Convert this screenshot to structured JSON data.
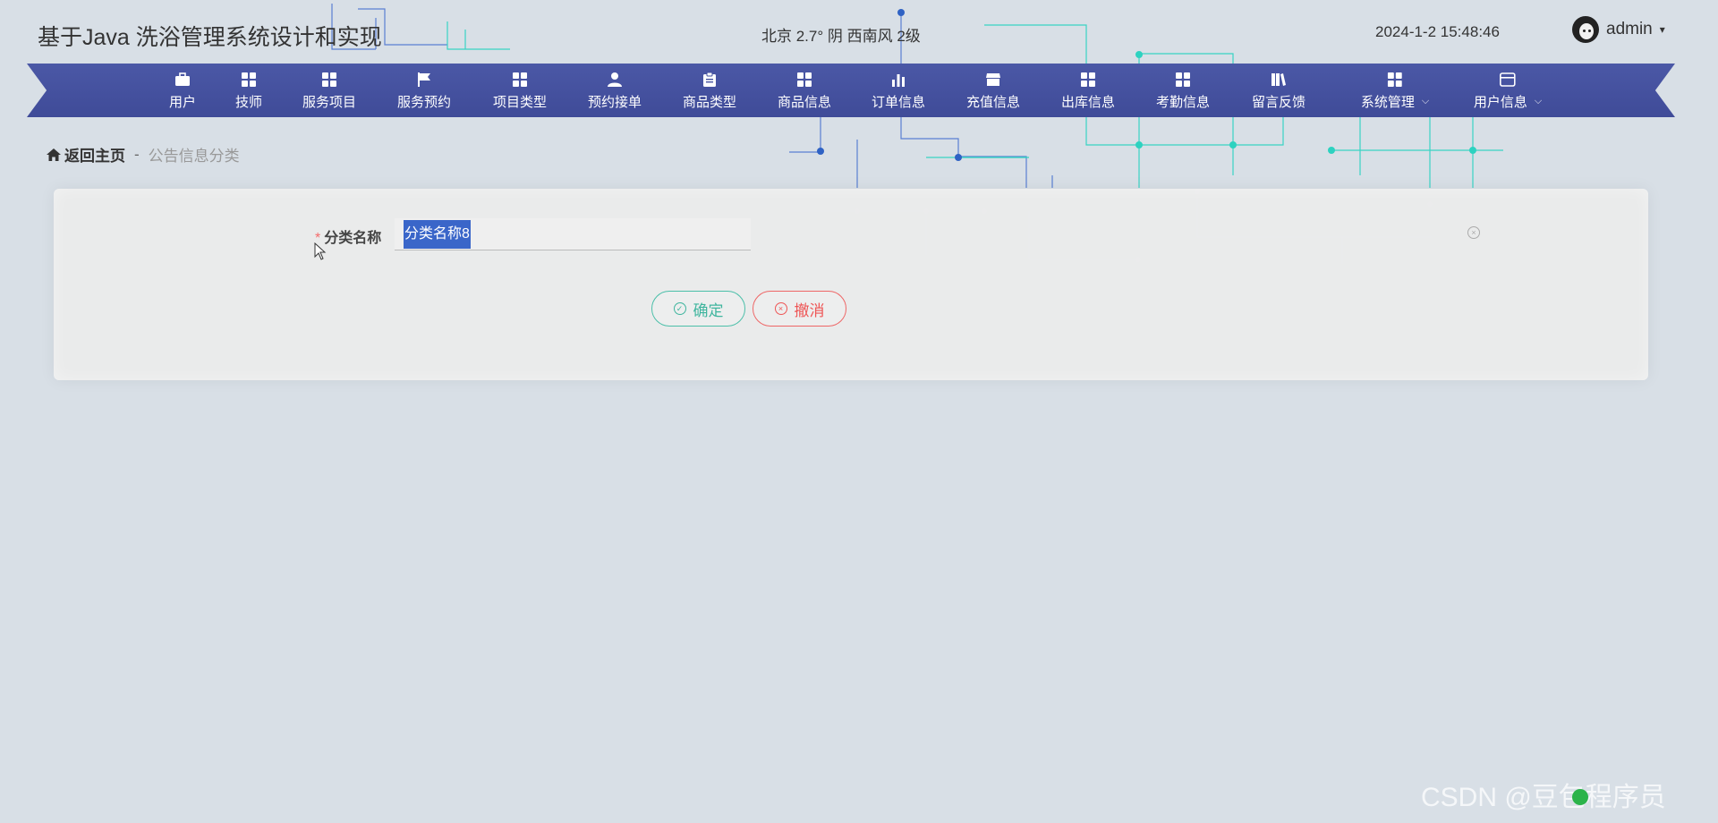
{
  "header": {
    "site_title": "基于Java 洗浴管理系统设计和实现",
    "weather": "北京  2.7°  阴  西南风  2级",
    "datetime": "2024-1-2 15:48:46",
    "user_name": "admin",
    "user_caret": "▾"
  },
  "nav": {
    "items": [
      {
        "label": "用户",
        "icon": "briefcase-icon"
      },
      {
        "label": "技师",
        "icon": "grid-icon"
      },
      {
        "label": "服务项目",
        "icon": "grid-icon"
      },
      {
        "label": "服务预约",
        "icon": "flag-icon"
      },
      {
        "label": "项目类型",
        "icon": "grid-icon"
      },
      {
        "label": "预约接单",
        "icon": "person-icon"
      },
      {
        "label": "商品类型",
        "icon": "clipboard-icon"
      },
      {
        "label": "商品信息",
        "icon": "grid-icon"
      },
      {
        "label": "订单信息",
        "icon": "bar-chart-icon"
      },
      {
        "label": "充值信息",
        "icon": "store-icon"
      },
      {
        "label": "出库信息",
        "icon": "grid-icon"
      },
      {
        "label": "考勤信息",
        "icon": "grid-icon"
      },
      {
        "label": "留言反馈",
        "icon": "books-icon"
      },
      {
        "label": "系统管理",
        "icon": "grid-icon",
        "dropdown": "⌵"
      },
      {
        "label": "用户信息",
        "icon": "wallet-icon",
        "dropdown": "⌵"
      }
    ]
  },
  "breadcrumb": {
    "home_label": "返回主页",
    "separator": "-",
    "current": "公告信息分类"
  },
  "form": {
    "required_mark": "*",
    "field_label": "分类名称",
    "field_value": "分类名称8",
    "clear_glyph": "×",
    "confirm_label": "确定",
    "confirm_glyph": "✓",
    "cancel_label": "撤消",
    "cancel_glyph": "×"
  },
  "watermark": "CSDN @豆包程序员",
  "colors": {
    "nav_bg": "#4452a0",
    "page_bg": "#d8dfe6",
    "confirm": "#3fb59e",
    "cancel": "#ee5555",
    "selection": "#3a66c9",
    "circuit_blue": "#2f62c4",
    "circuit_teal": "#2dd2c0"
  }
}
